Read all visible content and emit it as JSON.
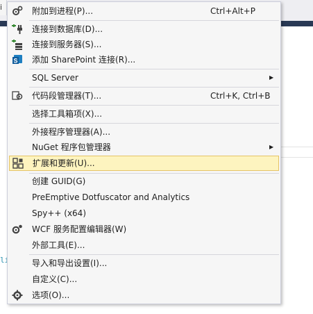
{
  "background": {
    "tab_fragment": "i",
    "code_fragment": "li"
  },
  "menu": {
    "items": [
      {
        "label": "附加到进程(P)...",
        "shortcut": "Ctrl+Alt+P",
        "icon": "gear-attach-icon"
      },
      {
        "label": "连接到数据库(D)...",
        "icon": "database-plug-icon"
      },
      {
        "label": "连接到服务器(S)...",
        "icon": "server-plug-icon"
      },
      {
        "label": "添加 SharePoint 连接(R)...",
        "icon": "sharepoint-icon"
      },
      {
        "label": "SQL Server",
        "submenu": true
      },
      {
        "label": "代码段管理器(T)...",
        "shortcut": "Ctrl+K, Ctrl+B",
        "icon": "snippet-manager-icon"
      },
      {
        "label": "选择工具箱项(X)..."
      },
      {
        "label": "外接程序管理器(A)..."
      },
      {
        "label": "NuGet 程序包管理器",
        "submenu": true
      },
      {
        "label": "扩展和更新(U)...",
        "icon": "extensions-icon",
        "highlighted": true
      },
      {
        "label": "创建 GUID(G)"
      },
      {
        "label": "PreEmptive Dotfuscator and Analytics"
      },
      {
        "label": "Spy++ (x64)"
      },
      {
        "label": "WCF 服务配置编辑器(W)",
        "icon": "wcf-config-icon"
      },
      {
        "label": "外部工具(E)..."
      },
      {
        "label": "导入和导出设置(I)..."
      },
      {
        "label": "自定义(C)..."
      },
      {
        "label": "选项(O)...",
        "icon": "options-gear-icon"
      }
    ],
    "submenu_arrow": "▶"
  },
  "colors": {
    "highlight_bg": "#fdf4bf",
    "highlight_border": "#e5c365",
    "menu_bg": "#f6f6f6",
    "title_bar": "#293955"
  }
}
